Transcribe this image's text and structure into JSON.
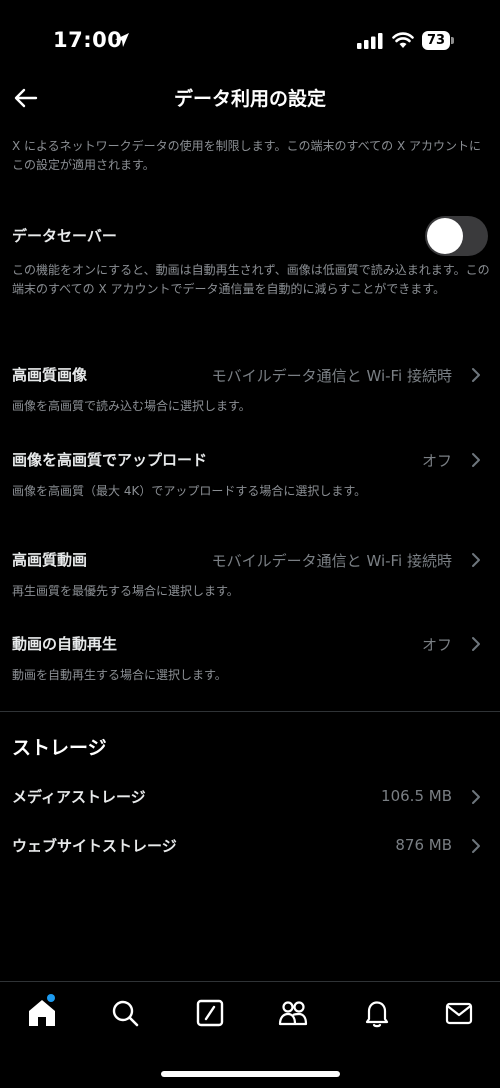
{
  "status": {
    "time": "17:00",
    "battery": "73"
  },
  "header": {
    "title": "データ利用の設定"
  },
  "intro": "X によるネットワークデータの使用を制限します。この端末のすべての X アカウントにこの設定が適用されます。",
  "data_saver": {
    "label": "データセーバー",
    "enabled": false,
    "description": "この機能をオンにすると、動画は自動再生されず、画像は低画質で読み込まれます。この端末のすべての X アカウントでデータ通信量を自動的に減らすことができます。"
  },
  "settings": [
    {
      "label": "高画質画像",
      "value": "モバイルデータ通信と Wi-Fi 接続時",
      "description": "画像を高画質で読み込む場合に選択します。"
    },
    {
      "label": "画像を高画質でアップロード",
      "value": "オフ",
      "description": "画像を高画質（最大 4K）でアップロードする場合に選択します。"
    },
    {
      "label": "高画質動画",
      "value": "モバイルデータ通信と Wi-Fi 接続時",
      "description": "再生画質を最優先する場合に選択します。"
    },
    {
      "label": "動画の自動再生",
      "value": "オフ",
      "description": "動画を自動再生する場合に選択します。"
    }
  ],
  "storage": {
    "title": "ストレージ",
    "items": [
      {
        "label": "メディアストレージ",
        "value": "106.5 MB"
      },
      {
        "label": "ウェブサイトストレージ",
        "value": "876 MB"
      }
    ]
  },
  "tabbar": {
    "items": [
      "home-icon",
      "search-icon",
      "compose-icon",
      "communities-icon",
      "bell-icon",
      "mail-icon"
    ],
    "accent": "#1d9bf0"
  }
}
